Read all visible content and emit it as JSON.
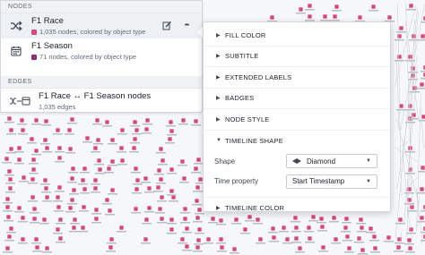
{
  "panel": {
    "nodes_header": "NODES",
    "edges_header": "EDGES",
    "nodes": [
      {
        "title": "F1 Race",
        "subtitle": "1,035 nodes, colored by object type",
        "swatch": "#d9467d",
        "icon": "shuffle-icon"
      },
      {
        "title": "F1 Season",
        "subtitle": "71 nodes, colored by object type",
        "swatch": "#8e2e7a",
        "icon": "calendar-icon"
      }
    ],
    "edges": [
      {
        "title": "F1 Race ↔ F1 Season nodes",
        "subtitle": "1,035 edges",
        "icon": "edge-link-icon"
      }
    ],
    "actions": {
      "edit_icon": "edit-icon",
      "more_icon": "more-icon",
      "more_glyph": "•••"
    }
  },
  "popover": {
    "sections": [
      {
        "label": "FILL COLOR"
      },
      {
        "label": "SUBTITLE"
      },
      {
        "label": "EXTENDED LABELS"
      },
      {
        "label": "BADGES"
      },
      {
        "label": "NODE STYLE"
      }
    ],
    "timeline_shape": {
      "label": "TIMELINE SHAPE",
      "shape_label": "Shape",
      "shape_value": "Diamond",
      "time_label": "Time property",
      "time_value": "Start Timestamp"
    },
    "timeline_color": {
      "label": "TIMELINE COLOR"
    }
  },
  "colors": {
    "node_pink": "#d9467d",
    "node_purple": "#8e2e7a",
    "accent": "#2d72d2"
  }
}
